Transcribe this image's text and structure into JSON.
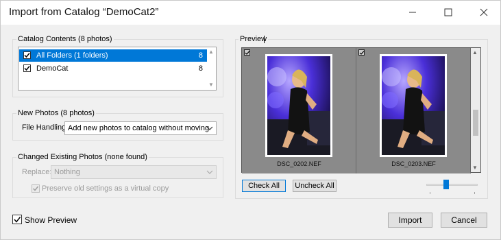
{
  "window": {
    "title": "Import from Catalog “DemoCat2”"
  },
  "catalog": {
    "group_label": "Catalog Contents (8 photos)",
    "items": [
      {
        "label": "All Folders (1 folders)",
        "count": "8",
        "checked": true,
        "selected": true
      },
      {
        "label": "DemoCat",
        "count": "8",
        "checked": true,
        "selected": false
      }
    ]
  },
  "new_photos": {
    "group_label": "New Photos (8 photos)",
    "file_handling_label": "File Handling:",
    "file_handling_value": "Add new photos to catalog without moving"
  },
  "changed_photos": {
    "group_label": "Changed Existing Photos (none found)",
    "replace_label": "Replace:",
    "replace_value": "Nothing",
    "preserve_label": "Preserve old settings as a virtual copy"
  },
  "preview": {
    "group_label": "Preview",
    "thumbnails": [
      {
        "filename": "DSC_0202.NEF"
      },
      {
        "filename": "DSC_0203.NEF"
      }
    ],
    "thumbnail_size_level": 0.38
  },
  "buttons": {
    "check_all": "Check All",
    "uncheck_all": "Uncheck All",
    "import": "Import",
    "cancel": "Cancel"
  },
  "footer": {
    "show_preview_label": "Show Preview",
    "show_preview_checked": true
  },
  "colors": {
    "selection": "#0078d7",
    "preview_bg": "#7c7c7c"
  }
}
